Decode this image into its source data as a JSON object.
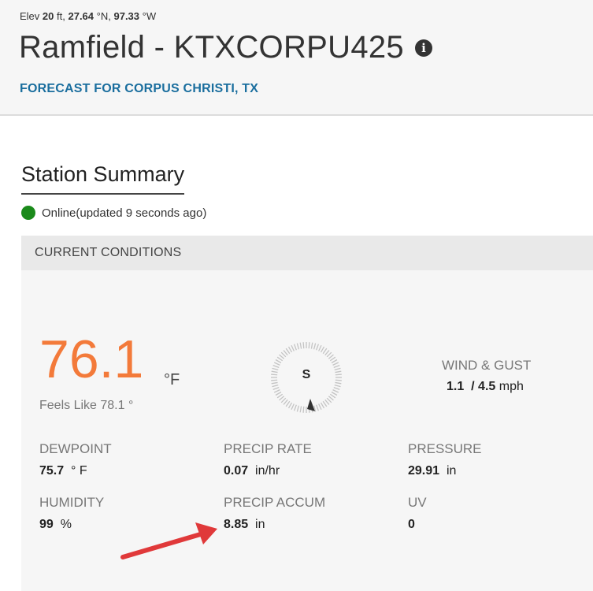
{
  "header": {
    "elev_prefix": "Elev",
    "elev_value": "20",
    "elev_unit": "ft,",
    "lat_value": "27.64",
    "lat_unit": "°N,",
    "lon_value": "97.33",
    "lon_unit": "°W",
    "station_title": "Ramfield - KTXCORPU425",
    "info_icon": "i",
    "forecast_link": "FORECAST FOR CORPUS CHRISTI, TX"
  },
  "summary": {
    "title": "Station Summary",
    "status": "Online(updated 9 seconds ago)",
    "status_color": "#1a8a1a"
  },
  "current": {
    "header": "CURRENT CONDITIONS",
    "temperature": "76.1",
    "temperature_unit": "°F",
    "feels_like": "Feels Like 78.1 °",
    "wind_direction": "S",
    "wind_label": "WIND & GUST",
    "wind_speed": "1.1",
    "wind_separator": "/",
    "wind_gust": "4.5",
    "wind_unit": "mph",
    "dewpoint_label": "DEWPOINT",
    "dewpoint_value": "75.7",
    "dewpoint_unit": "° F",
    "precip_rate_label": "PRECIP RATE",
    "precip_rate_value": "0.07",
    "precip_rate_unit": "in/hr",
    "pressure_label": "PRESSURE",
    "pressure_value": "29.91",
    "pressure_unit": "in",
    "humidity_label": "HUMIDITY",
    "humidity_value": "99",
    "humidity_unit": "%",
    "precip_accum_label": "PRECIP ACCUM",
    "precip_accum_value": "8.85",
    "precip_accum_unit": "in",
    "uv_label": "UV",
    "uv_value": "0"
  },
  "colors": {
    "temperature": "#f37a3a",
    "link": "#1a6e9e",
    "annotation_arrow": "#e0393a"
  },
  "icons": {
    "info": "info-icon",
    "compass": "compass-icon",
    "annotation": "red-arrow-annotation"
  }
}
